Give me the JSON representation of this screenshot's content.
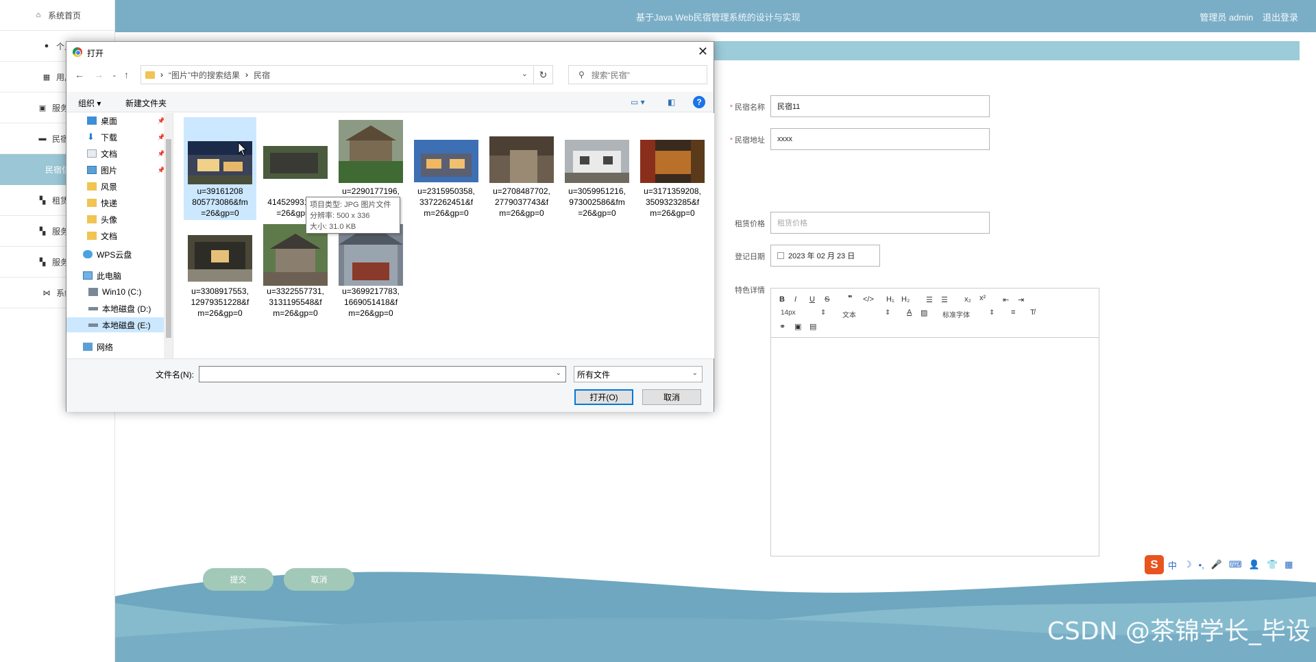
{
  "app": {
    "title": "基于Java Web民宿管理系统的设计与实现",
    "user_label": "管理员 admin",
    "logout": "退出登录"
  },
  "sidebar": {
    "items": [
      {
        "label": "系统首页",
        "icon": "home-icon"
      },
      {
        "label": "个人",
        "icon": "person-icon"
      },
      {
        "label": "用户",
        "icon": "grid-icon"
      },
      {
        "label": "服务类",
        "icon": "clipboard-icon"
      },
      {
        "label": "民宿信",
        "icon": "briefcase-icon"
      },
      {
        "label": "民宿信",
        "icon": "",
        "active": true
      },
      {
        "label": "租赁订",
        "icon": "grid-icon"
      },
      {
        "label": "服务信",
        "icon": "grid-icon"
      },
      {
        "label": "服务订",
        "icon": "grid-icon"
      },
      {
        "label": "系统",
        "icon": "bowtie-icon"
      }
    ]
  },
  "form": {
    "name_label": "民宿名称",
    "name_value": "民宿11",
    "address_label": "民宿地址",
    "address_value": "xxxx",
    "price_label": "租赁价格",
    "price_placeholder": "租赁价格",
    "date_label": "登记日期",
    "date_value": "2023 年 02 月 23 日",
    "detail_label": "特色详情",
    "editor": {
      "font_size": "14px",
      "paragraph": "文本",
      "font_family": "标准字体"
    },
    "submit": "提交",
    "cancel": "取消"
  },
  "ime": {
    "logo": "S",
    "items": [
      "中",
      "☽",
      "•,",
      "🎤",
      "⌨",
      "👤",
      "👕",
      "▦"
    ]
  },
  "watermark": "CSDN @茶锦学长_毕设",
  "dialog": {
    "title": "打开",
    "breadcrumb": [
      "“图片”中的搜索结果",
      "民宿"
    ],
    "search_placeholder": "搜索“民宿”",
    "organize": "组织 ▾",
    "new_folder": "新建文件夹",
    "nav_items": [
      {
        "label": "桌面",
        "pinned": true
      },
      {
        "label": "下载",
        "pinned": true
      },
      {
        "label": "文档",
        "pinned": true
      },
      {
        "label": "图片",
        "pinned": true
      },
      {
        "label": "风景"
      },
      {
        "label": "快递"
      },
      {
        "label": "头像"
      },
      {
        "label": "文档"
      },
      {
        "label": "WPS云盘"
      },
      {
        "label": "此电脑"
      },
      {
        "label": "Win10 (C:)"
      },
      {
        "label": "本地磁盘 (D:)"
      },
      {
        "label": "本地磁盘 (E:)",
        "selected": true
      },
      {
        "label": "网络"
      }
    ],
    "files": [
      {
        "name": "u=3916120843,2805773086&fm=26&gp=0",
        "shown": "u=39161208\n805773086&fm\n=26&gp=0",
        "selected": true
      },
      {
        "name": "u=...414529931&fm=26&gp=0",
        "shown": "414529931&fm\n=26&gp=0"
      },
      {
        "name": "u=2290177196,741290271&fm=26&gp=0",
        "shown": "u=2290177196,\n741290271&fm\n=26&gp=0"
      },
      {
        "name": "u=2315950358,3372262451&fm=26&gp=0",
        "shown": "u=2315950358,\n3372262451&f\nm=26&gp=0"
      },
      {
        "name": "u=2708487702,2779037743&fm=26&gp=0",
        "shown": "u=2708487702,\n2779037743&f\nm=26&gp=0"
      },
      {
        "name": "u=3059951216,973002586&fm=26&gp=0",
        "shown": "u=3059951216,\n973002586&fm\n=26&gp=0"
      },
      {
        "name": "u=3171359208,3509323285&fm=26&gp=0",
        "shown": "u=3171359208,\n3509323285&f\nm=26&gp=0"
      },
      {
        "name": "u=3308917553,12979351228&fm=26&gp=0",
        "shown": "u=3308917553,\n12979351228&f\nm=26&gp=0"
      },
      {
        "name": "u=3322557731,3131195548&fm=26&gp=0",
        "shown": "u=3322557731,\n3131195548&f\nm=26&gp=0"
      },
      {
        "name": "u=3699217783,1669051418&fm=26&gp=0",
        "shown": "u=3699217783,\n1669051418&f\nm=26&gp=0"
      }
    ],
    "tooltip": [
      "项目类型: JPG 图片文件",
      "分辨率: 500 x 336",
      "大小: 31.0 KB"
    ],
    "filename_label": "文件名(N):",
    "filename_value": "",
    "filetype": "所有文件",
    "open_button": "打开(O)",
    "cancel_button": "取消"
  }
}
